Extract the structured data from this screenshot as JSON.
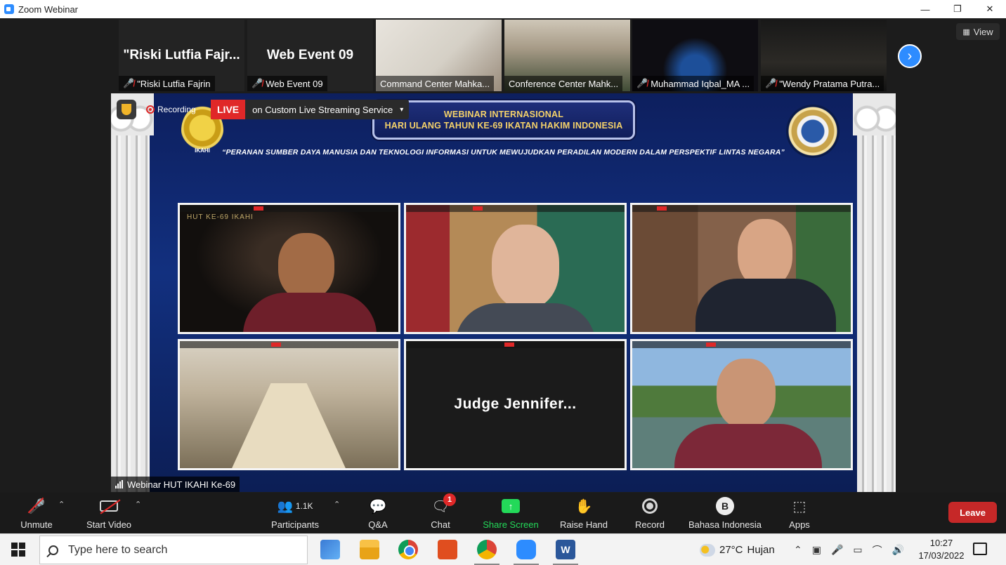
{
  "window": {
    "title": "Zoom Webinar",
    "controls": [
      "—",
      "❐",
      "✕"
    ]
  },
  "view_button": {
    "label": "View"
  },
  "thumbnails": [
    {
      "big_name": "\"Riski Lutfia Fajr...",
      "caption": "\"Riski Lutfia Fajrin",
      "muted": true,
      "video": false
    },
    {
      "big_name": "Web Event 09",
      "caption": "Web Event 09",
      "muted": true,
      "video": false
    },
    {
      "big_name": "",
      "caption": "Command Center Mahka...",
      "muted": false,
      "video": true
    },
    {
      "big_name": "",
      "caption": "Conference Center Mahk...",
      "muted": false,
      "video": true
    },
    {
      "big_name": "",
      "caption": "Muhammad Iqbal_MA ...",
      "muted": true,
      "video": true
    },
    {
      "big_name": "",
      "caption": "\"Wendy Pratama Putra...",
      "muted": true,
      "video": true
    }
  ],
  "share": {
    "recording_label": "Recording",
    "live_badge": "LIVE",
    "live_text": "on Custom Live Streaming Service",
    "banner_line1": "WEBINAR INTERNASIONAL",
    "banner_line2": "HARI ULANG TAHUN KE-69 IKATAN HAKIM INDONESIA",
    "subtitle": "“PERANAN SUMBER DAYA MANUSIA DAN TEKNOLOGI INFORMASI UNTUK MEWUJUDKAN PERADILAN MODERN DALAM PERSPEKTIF LINTAS NEGARA”",
    "left_seal_text": "IKAHI",
    "tile1_caption": "HUT KE-69 IKAHI",
    "tile5_name": "Judge  Jennifer...",
    "label": "Webinar HUT IKAHI Ke-69"
  },
  "toolbar": {
    "unmute": "Unmute",
    "start_video": "Start Video",
    "participants": "Participants",
    "participants_count": "1.1K",
    "qa": "Q&A",
    "chat": "Chat",
    "chat_badge": "1",
    "share_screen": "Share Screen",
    "raise_hand": "Raise Hand",
    "record": "Record",
    "language": "Bahasa Indonesia",
    "language_initial": "B",
    "apps": "Apps",
    "leave": "Leave"
  },
  "taskbar": {
    "search_placeholder": "Type here to search",
    "temperature": "27°C",
    "weather": "Hujan",
    "time": "10:27",
    "date": "17/03/2022"
  }
}
